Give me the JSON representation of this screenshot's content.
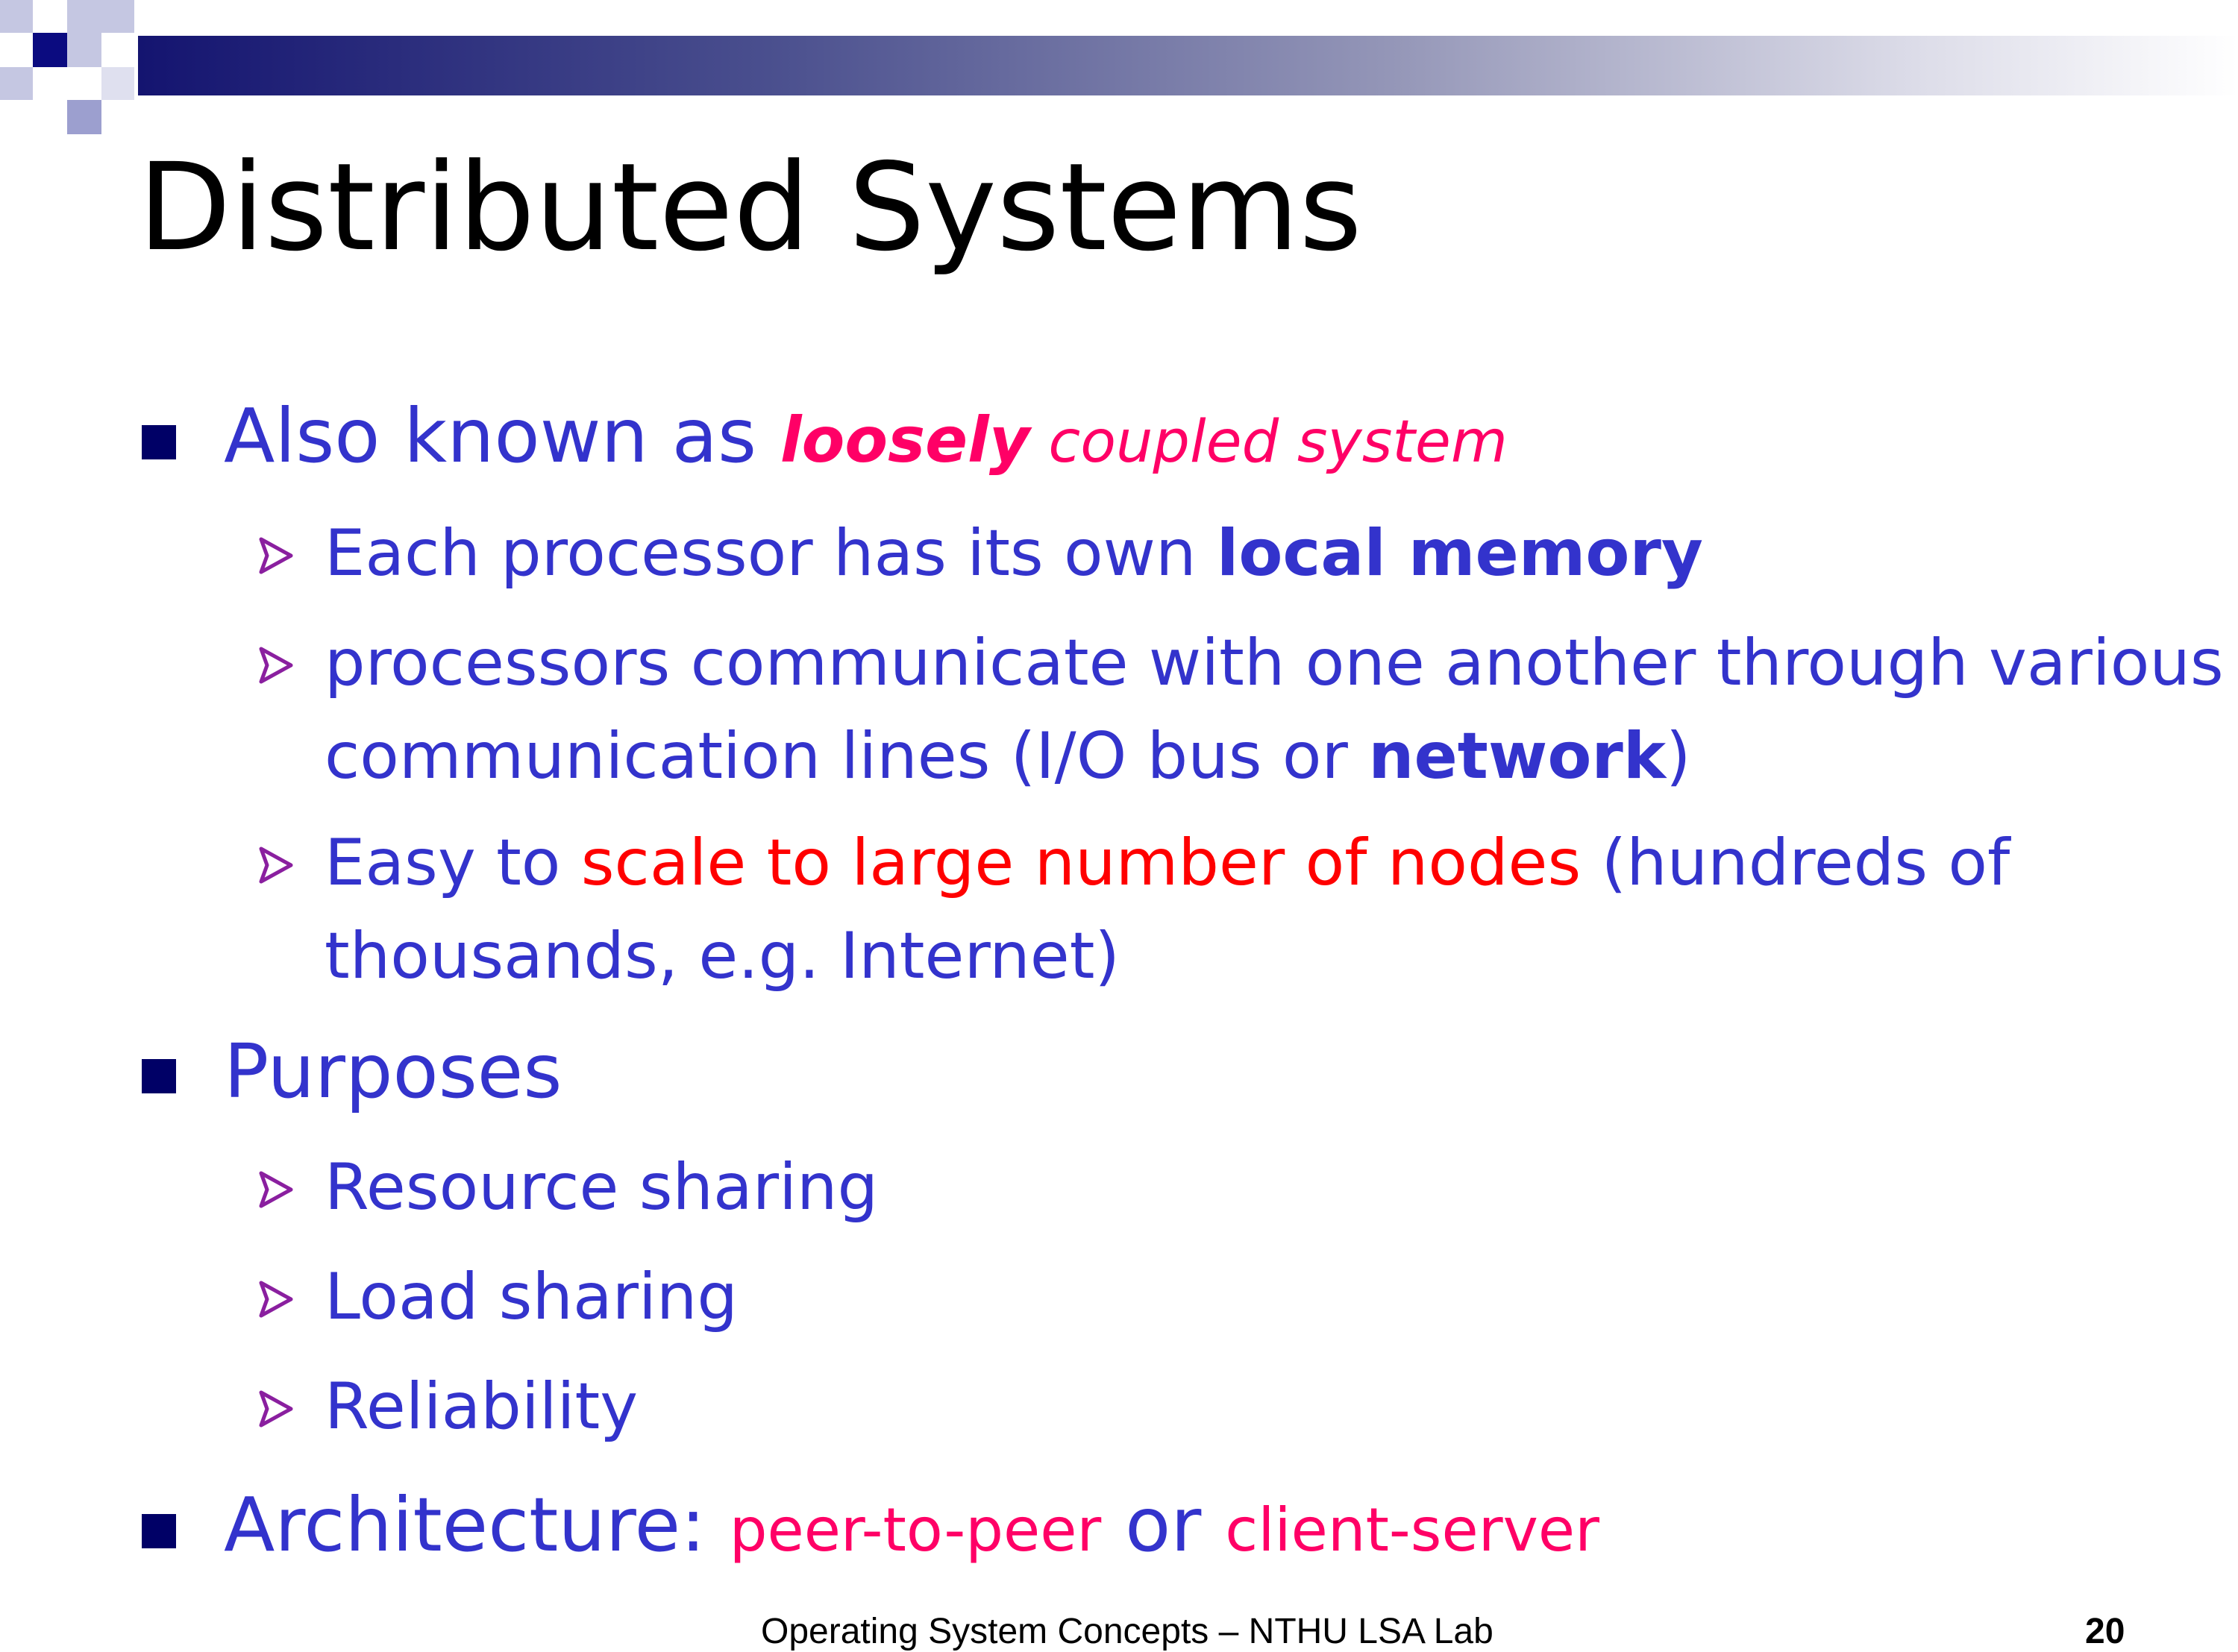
{
  "slide": {
    "title": "Distributed Systems",
    "bullets": [
      {
        "text": "Also known as ",
        "emphasis_1": "loosely",
        "emphasis_2": " coupled system",
        "sub": [
          {
            "text": "Each processor has its own ",
            "bold": "local memory"
          },
          {
            "line1": "processors communicate with one another through various",
            "line2_pre": "communication lines (I/O bus or ",
            "bold": "network",
            "line2_post": ")"
          },
          {
            "pre": "Easy to ",
            "red": "scale to large number of nodes",
            "post": " (hundreds of",
            "line2": "thousands, e.g. Internet)"
          }
        ]
      },
      {
        "text": "Purposes",
        "sub": [
          "Resource sharing",
          "Load sharing",
          "Reliability"
        ]
      },
      {
        "text": "Architecture: ",
        "opt1": "peer-to-peer",
        "mid": " or ",
        "opt2": "client-server"
      }
    ],
    "footer": "Operating System Concepts – NTHU LSA Lab",
    "page_number": "20"
  },
  "colors": {
    "text_blue": "#3333cc",
    "accent_red": "#ff0000",
    "accent_pink": "#ff0066",
    "bullet_navy": "#000066",
    "arrow_purple": "#8a1f9f"
  }
}
